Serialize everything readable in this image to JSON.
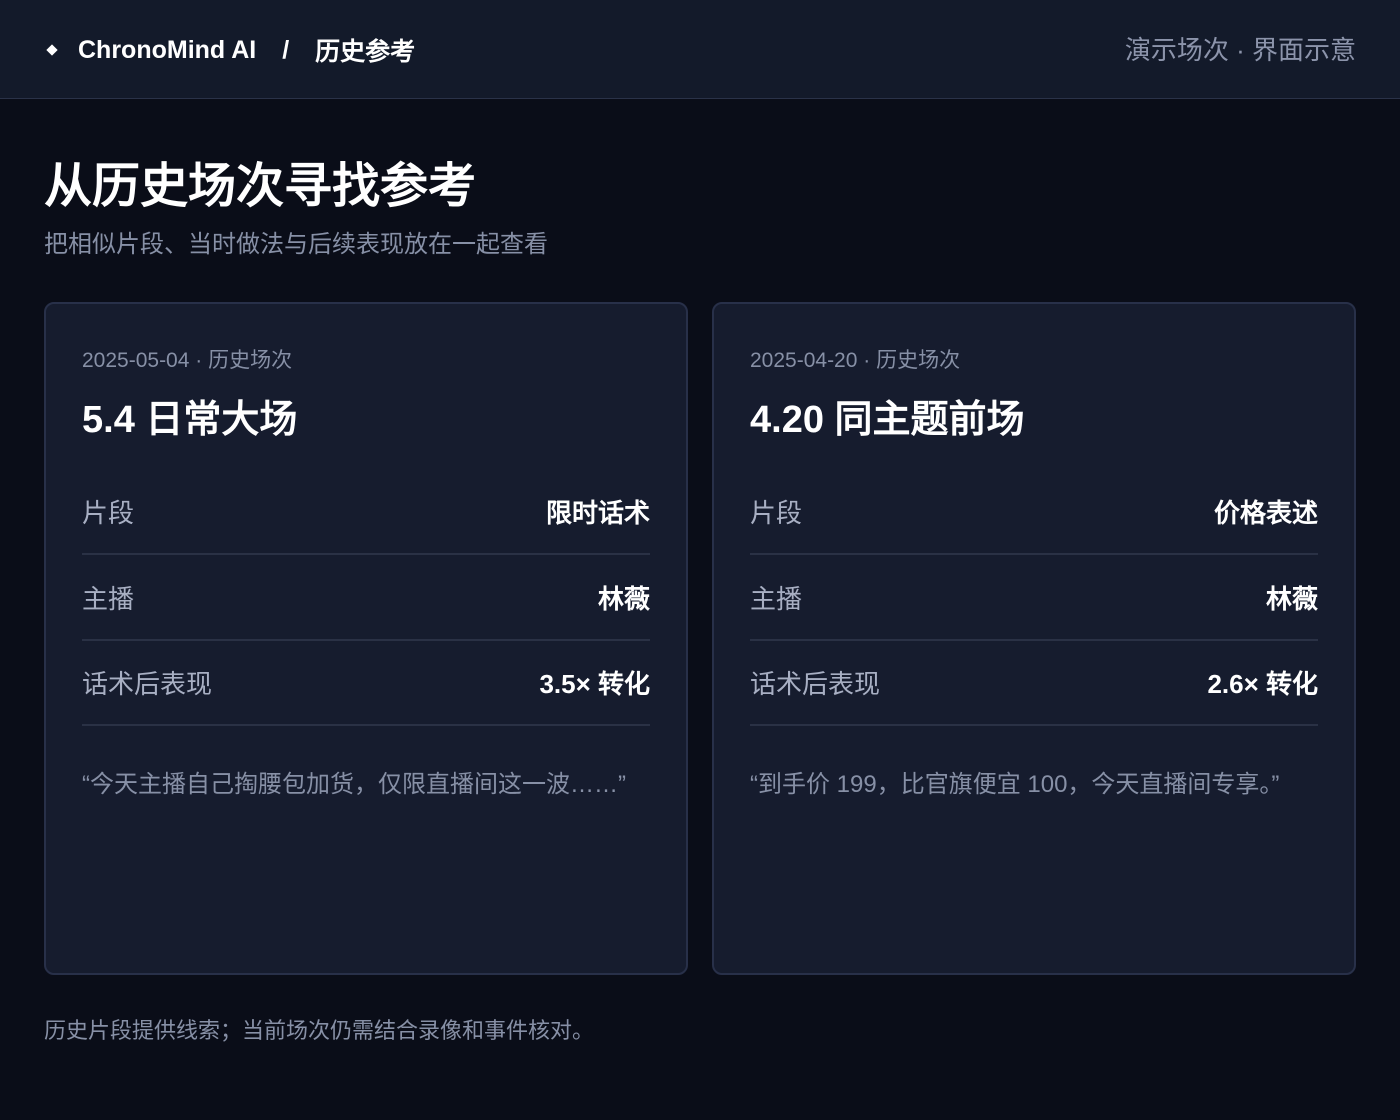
{
  "header": {
    "app_name": "ChronoMind AI",
    "separator": "/",
    "section": "历史参考",
    "right_note": "演示场次 · 界面示意",
    "brand_icon": "diamond-icon"
  },
  "main": {
    "title": "从历史场次寻找参考",
    "subtitle": "把相似片段、当时做法与后续表现放在一起查看"
  },
  "cards": [
    {
      "meta": "2025-05-04 · 历史场次",
      "title": "5.4 日常大场",
      "rows": [
        {
          "label": "片段",
          "value": "限时话术"
        },
        {
          "label": "主播",
          "value": "林薇"
        },
        {
          "label": "话术后表现",
          "value": "3.5× 转化"
        }
      ],
      "quote": "“今天主播自己掏腰包加货，仅限直播间这一波……”"
    },
    {
      "meta": "2025-04-20 · 历史场次",
      "title": "4.20 同主题前场",
      "rows": [
        {
          "label": "片段",
          "value": "价格表述"
        },
        {
          "label": "主播",
          "value": "林薇"
        },
        {
          "label": "话术后表现",
          "value": "2.6× 转化"
        }
      ],
      "quote": "“到手价 199，比官旗便宜 100，今天直播间专享。”"
    }
  ],
  "footer": {
    "note": "历史片段提供线索；当前场次仍需结合录像和事件核对。"
  },
  "colors": {
    "background": "#0a0d18",
    "topbar": "#131a2a",
    "card": "#161c2e",
    "muted_text": "#8790a6"
  }
}
